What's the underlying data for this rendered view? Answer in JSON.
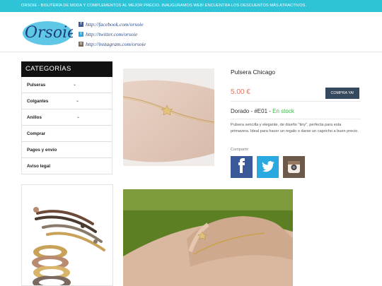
{
  "topbar": {
    "text": "ORSOIE - BISUTERÍA DE MODA Y COMPLEMENTOS AL MEJOR PRECIO. INAUGURAMOS WEB! ENCUENTRA LOS DESCUENTOS MÁS ATRACTIVOS."
  },
  "header": {
    "logo_text": "Orsoie",
    "links": [
      {
        "icon": "facebook-icon",
        "glyph": "f",
        "text": "http://facebook.com/orsoie"
      },
      {
        "icon": "twitter-icon",
        "glyph": "t",
        "text": "http://twitter.com/orsoie"
      },
      {
        "icon": "instagram-icon",
        "glyph": "◘",
        "text": "http://instagram.com/orsoie"
      }
    ]
  },
  "sidebar": {
    "title": "CATEGORÍAS",
    "items": [
      {
        "label": "Pulseras",
        "chevron": "⌄"
      },
      {
        "label": "Colgantes",
        "chevron": "⌄"
      },
      {
        "label": "Anillos",
        "chevron": "⌄"
      },
      {
        "label": "Comprar",
        "chevron": ""
      },
      {
        "label": "Pagos y envío",
        "chevron": ""
      },
      {
        "label": "Aviso legal",
        "chevron": ""
      }
    ]
  },
  "product": {
    "title": "Pulsera Chicago",
    "price": "5.00 €",
    "buy_label": "COMPRA YA!",
    "variant": "Dorado - #E01 - ",
    "stock": "En stock",
    "description": "Pulsera sencilla y elegante, de diseño \"tiny\", perfecta para esta primavera. Ideal para hacer un regalo o darse un capricho a buen precio.",
    "share_label": "Compartir:"
  },
  "colors": {
    "accent": "#2fc3d8",
    "price": "#e8715a",
    "stock": "#3bb54a",
    "button": "#34495e"
  }
}
